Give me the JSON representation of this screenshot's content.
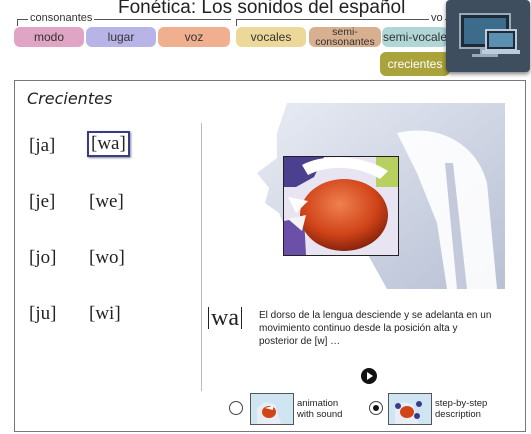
{
  "header": {
    "title": "Fonética:  Los sonidos del español",
    "group_consonantes": "consonantes",
    "group_vocales": "vo",
    "tabs": {
      "modo": "modo",
      "lugar": "lugar",
      "voz": "voz",
      "vocales": "vocales",
      "semiconsonantes": "semi-\nconsonantes",
      "semivocales": "semi-vocale",
      "crecientes": "crecientes"
    }
  },
  "panel": {
    "title": "Crecientes",
    "syllables": {
      "ja": "[ja]",
      "wa": "[wa]",
      "je": "[je]",
      "we": "[we]",
      "jo": "[jo]",
      "wo": "[wo]",
      "ju": "[ju]",
      "wi": "[wi]"
    },
    "description": {
      "ipa": "wa",
      "text": "El dorso de la lengua desciende y se adelanta en un movimiento continuo desde la posición alta y posterior de [w]  …"
    },
    "options": {
      "animation": "animation\nwith sound",
      "step": "step-by-step\ndescription"
    }
  },
  "colors": {
    "modo": "#e0a4c4",
    "lugar": "#b8b4e8",
    "voz": "#f0b090",
    "vocales": "#ecd898",
    "semiconsonantes": "#d8b090",
    "semivocales": "#b0d6d6",
    "crecientes": "#aaa23a"
  }
}
